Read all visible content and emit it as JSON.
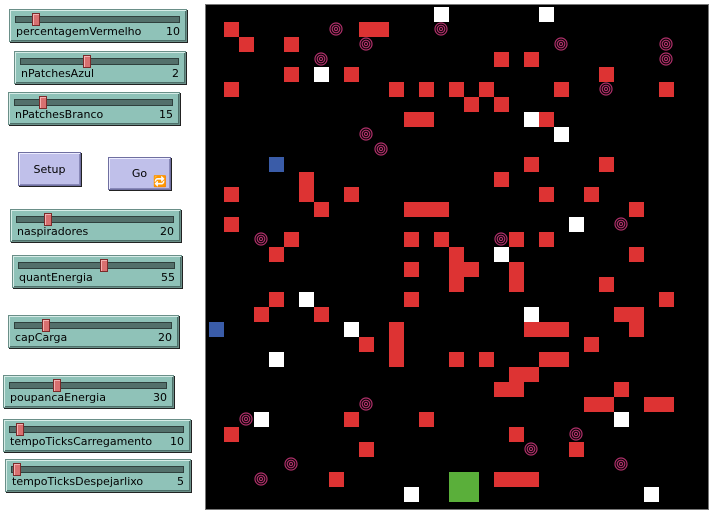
{
  "sliders": [
    {
      "id": "percentagem-vermelho",
      "label": "percentagemVermelho",
      "value": "10",
      "fraction": 0.12
    },
    {
      "id": "npatches-azul",
      "label": "nPatchesAzul",
      "value": "2",
      "fraction": 0.42
    },
    {
      "id": "npatches-branco",
      "label": "nPatchesBranco",
      "value": "15",
      "fraction": 0.18
    },
    {
      "id": "naspiradores",
      "label": "naspiradores",
      "value": "20",
      "fraction": 0.2
    },
    {
      "id": "quant-energia",
      "label": "quantEnergia",
      "value": "55",
      "fraction": 0.55
    },
    {
      "id": "cap-carga",
      "label": "capCarga",
      "value": "20",
      "fraction": 0.2
    },
    {
      "id": "poupanca-energia",
      "label": "poupancaEnergia",
      "value": "30",
      "fraction": 0.3
    },
    {
      "id": "tempo-ticks-carregamento",
      "label": "tempoTicksCarregamento",
      "value": "10",
      "fraction": 0.06
    },
    {
      "id": "tempo-ticks-despejar-lixo",
      "label": "tempoTicksDespejarlixo",
      "value": "5",
      "fraction": 0.03
    }
  ],
  "buttons": {
    "setup": "Setup",
    "go": "Go",
    "go_forever_icon": "forever-loop-icon"
  },
  "colors": {
    "red_patch": "#dd3333",
    "white_patch": "#ffffff",
    "blue_patch": "#3a5ca8",
    "green_patch": "#5aaf3a",
    "vacuum": "#b0306a",
    "background": "#000000"
  },
  "world": {
    "cols": 33,
    "rows": 33,
    "red": [
      [
        1,
        1
      ],
      [
        2,
        2
      ],
      [
        5,
        2
      ],
      [
        10,
        1
      ],
      [
        11,
        1
      ],
      [
        19,
        3
      ],
      [
        21,
        3
      ],
      [
        1,
        5
      ],
      [
        5,
        4
      ],
      [
        9,
        4
      ],
      [
        12,
        5
      ],
      [
        14,
        5
      ],
      [
        16,
        5
      ],
      [
        18,
        5
      ],
      [
        23,
        5
      ],
      [
        26,
        4
      ],
      [
        30,
        5
      ],
      [
        17,
        6
      ],
      [
        19,
        6
      ],
      [
        13,
        7
      ],
      [
        14,
        7
      ],
      [
        22,
        7
      ],
      [
        6,
        11
      ],
      [
        6,
        12
      ],
      [
        7,
        13
      ],
      [
        9,
        12
      ],
      [
        13,
        13
      ],
      [
        14,
        13
      ],
      [
        15,
        13
      ],
      [
        19,
        11
      ],
      [
        21,
        10
      ],
      [
        22,
        12
      ],
      [
        25,
        12
      ],
      [
        26,
        10
      ],
      [
        28,
        13
      ],
      [
        1,
        12
      ],
      [
        1,
        14
      ],
      [
        5,
        15
      ],
      [
        13,
        15
      ],
      [
        15,
        15
      ],
      [
        20,
        15
      ],
      [
        22,
        15
      ],
      [
        4,
        16
      ],
      [
        16,
        16
      ],
      [
        16,
        17
      ],
      [
        17,
        17
      ],
      [
        13,
        17
      ],
      [
        20,
        17
      ],
      [
        16,
        18
      ],
      [
        20,
        18
      ],
      [
        26,
        18
      ],
      [
        30,
        19
      ],
      [
        28,
        16
      ],
      [
        4,
        19
      ],
      [
        7,
        20
      ],
      [
        13,
        19
      ],
      [
        21,
        21
      ],
      [
        22,
        21
      ],
      [
        23,
        21
      ],
      [
        27,
        20
      ],
      [
        28,
        20
      ],
      [
        28,
        21
      ],
      [
        3,
        20
      ],
      [
        10,
        22
      ],
      [
        12,
        21
      ],
      [
        12,
        22
      ],
      [
        12,
        23
      ],
      [
        16,
        23
      ],
      [
        18,
        23
      ],
      [
        22,
        23
      ],
      [
        23,
        23
      ],
      [
        25,
        22
      ],
      [
        20,
        24
      ],
      [
        21,
        24
      ],
      [
        19,
        25
      ],
      [
        20,
        25
      ],
      [
        27,
        25
      ],
      [
        26,
        26
      ],
      [
        25,
        26
      ],
      [
        29,
        26
      ],
      [
        30,
        26
      ],
      [
        9,
        27
      ],
      [
        14,
        27
      ],
      [
        27,
        27
      ],
      [
        1,
        28
      ],
      [
        10,
        29
      ],
      [
        20,
        28
      ],
      [
        24,
        29
      ],
      [
        8,
        31
      ],
      [
        19,
        31
      ],
      [
        20,
        31
      ],
      [
        21,
        31
      ]
    ],
    "white": [
      [
        15,
        0
      ],
      [
        22,
        0
      ],
      [
        7,
        4
      ],
      [
        21,
        7
      ],
      [
        23,
        8
      ],
      [
        24,
        14
      ],
      [
        19,
        16
      ],
      [
        6,
        19
      ],
      [
        21,
        20
      ],
      [
        9,
        21
      ],
      [
        4,
        23
      ],
      [
        3,
        27
      ],
      [
        27,
        27
      ],
      [
        13,
        32
      ],
      [
        29,
        32
      ]
    ],
    "blue": [
      [
        4,
        10
      ],
      [
        0,
        21
      ]
    ],
    "green": [
      [
        16,
        31
      ],
      [
        16,
        32
      ],
      [
        17,
        31
      ],
      [
        17,
        32
      ]
    ],
    "vacuums": [
      [
        8,
        1
      ],
      [
        15,
        1
      ],
      [
        10,
        2
      ],
      [
        23,
        2
      ],
      [
        30,
        2
      ],
      [
        7,
        3
      ],
      [
        30,
        3
      ],
      [
        26,
        5
      ],
      [
        10,
        8
      ],
      [
        11,
        9
      ],
      [
        27,
        14
      ],
      [
        3,
        15
      ],
      [
        19,
        15
      ],
      [
        10,
        26
      ],
      [
        2,
        27
      ],
      [
        24,
        28
      ],
      [
        5,
        30
      ],
      [
        21,
        29
      ],
      [
        27,
        30
      ],
      [
        3,
        31
      ]
    ]
  }
}
